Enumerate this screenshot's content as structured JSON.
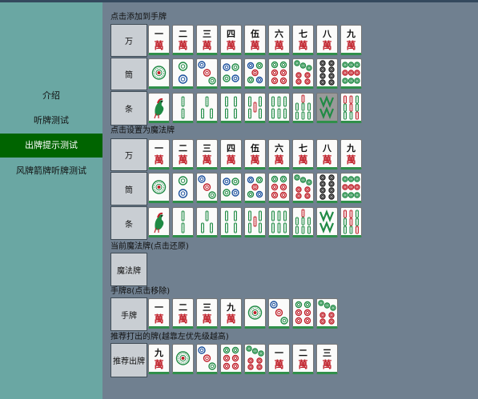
{
  "sidebar": {
    "items": [
      {
        "label": "介绍"
      },
      {
        "label": "听牌测试"
      },
      {
        "label": "出牌提示测试",
        "active": true
      },
      {
        "label": "风牌箭牌听牌测试"
      }
    ]
  },
  "colors": {
    "background": "#708090",
    "sidebar": "#6aa7a3",
    "active_nav": "#006400",
    "tile_edge": "#2f8f4a",
    "wan_red": "#c0202a"
  },
  "add_section": {
    "title": "点击添加到手牌",
    "rows": [
      {
        "label": "万",
        "suit": "wan"
      },
      {
        "label": "筒",
        "suit": "tong"
      },
      {
        "label": "条",
        "suit": "tiao"
      }
    ]
  },
  "magic_section": {
    "title": "点击设置为魔法牌",
    "rows": [
      {
        "label": "万",
        "suit": "wan"
      },
      {
        "label": "筒",
        "suit": "tong"
      },
      {
        "label": "条",
        "suit": "tiao"
      }
    ]
  },
  "selected_tile": {
    "suit": "tiao",
    "rank": 8
  },
  "wan_numerals": [
    "一",
    "二",
    "三",
    "四",
    "伍",
    "六",
    "七",
    "八",
    "九"
  ],
  "wan_char": "萬",
  "current_magic": {
    "title": "当前魔法牌(点击还原)",
    "label": "魔法牌"
  },
  "hand": {
    "title": "手牌8(点击移除)",
    "label": "手牌",
    "tiles": [
      {
        "suit": "wan",
        "rank": 1
      },
      {
        "suit": "wan",
        "rank": 2
      },
      {
        "suit": "wan",
        "rank": 3
      },
      {
        "suit": "wan",
        "rank": 9
      },
      {
        "suit": "tong",
        "rank": 1
      },
      {
        "suit": "tong",
        "rank": 3
      },
      {
        "suit": "tong",
        "rank": 6
      },
      {
        "suit": "tong",
        "rank": 7
      }
    ]
  },
  "recommend": {
    "title": "推荐打出的牌(越靠左优先级越高)",
    "label": "推荐出牌",
    "tiles": [
      {
        "suit": "wan",
        "rank": 9
      },
      {
        "suit": "tong",
        "rank": 1
      },
      {
        "suit": "tong",
        "rank": 3
      },
      {
        "suit": "tong",
        "rank": 6
      },
      {
        "suit": "tong",
        "rank": 7
      },
      {
        "suit": "wan",
        "rank": 1
      },
      {
        "suit": "wan",
        "rank": 2
      },
      {
        "suit": "wan",
        "rank": 3
      }
    ]
  }
}
